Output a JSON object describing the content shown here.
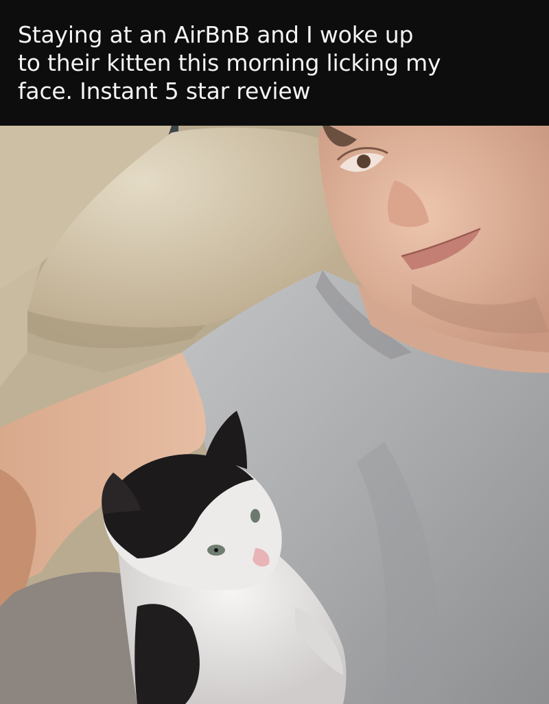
{
  "caption": {
    "text": "Staying at an AirBnB and I woke up\nto their kitten this morning licking my\nface. Instant 5 star review"
  },
  "photo": {
    "subject_icon": "selfie-with-kitten-photo"
  },
  "colors": {
    "caption_background": "#0d0d0e",
    "caption_text": "#f5f5f5",
    "pillow": "#d9ceb6",
    "shirt": "#a9aaac",
    "skin": "#e2b8a0",
    "kitten_black": "#1e1c1d",
    "kitten_white": "#ecebea"
  }
}
